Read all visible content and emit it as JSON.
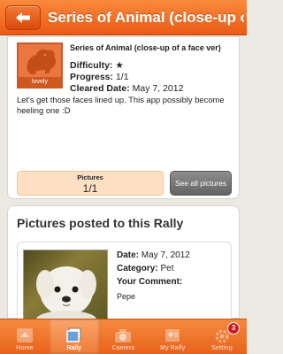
{
  "header": {
    "title": "Series of Animal (close-up of a face ver)",
    "back_icon": "back-arrow-icon"
  },
  "rally": {
    "thumb_label": "lovely",
    "title": "Series of Animal (close-up of a face ver)",
    "difficulty_label": "Difficulty:",
    "difficulty_value": "★",
    "progress_label": "Progress:",
    "progress_value": "1/1",
    "cleared_label": "Cleared Date:",
    "cleared_value": "May 7, 2012",
    "description": "Let's get those faces lined up.  This app possibly become heeling one :D",
    "pictures_label": "Pictures",
    "pictures_count": "1/1",
    "see_all_label": "See all pictures"
  },
  "posted": {
    "section_title": "Pictures posted to this Rally",
    "date_label": "Date:",
    "date_value": "May 7, 2012",
    "category_label": "Category:",
    "category_value": "Pet",
    "comment_label": "Your Comment:",
    "comment_value": "Pepe"
  },
  "tabbar": {
    "tabs": [
      {
        "label": "Home",
        "icon": "home-icon"
      },
      {
        "label": "Rally",
        "icon": "rally-icon"
      },
      {
        "label": "Camera",
        "icon": "camera-icon"
      },
      {
        "label": "My Rally",
        "icon": "my-rally-icon"
      },
      {
        "label": "Setting",
        "icon": "gear-icon"
      }
    ],
    "settings_badge": "3"
  },
  "colors": {
    "accent": "#ec5a16",
    "pictures_box": "#fde0c3",
    "badge": "#d9161c"
  }
}
